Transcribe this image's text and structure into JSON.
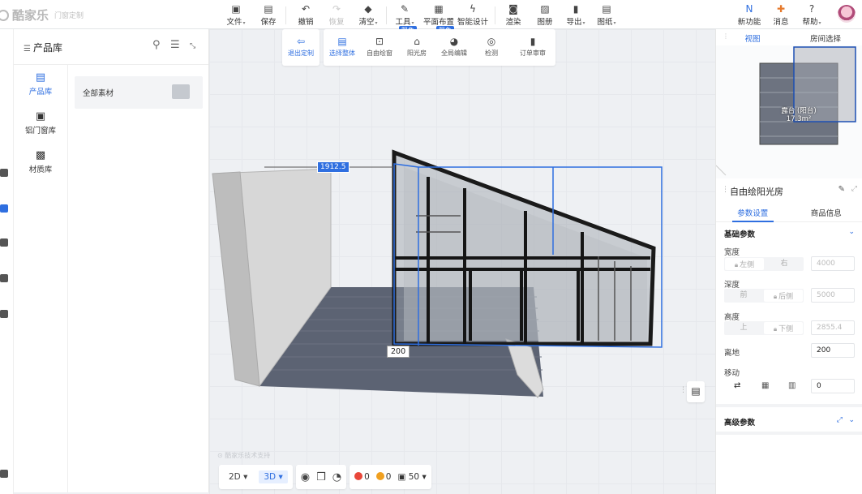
{
  "app": {
    "brand": "酷家乐",
    "module": "门窗定制"
  },
  "toolbar": {
    "file": "文件",
    "save": "保存",
    "undo": "撤销",
    "redo": "恢复",
    "clear": "清空",
    "tools": "工具",
    "layout": "平面布置",
    "smart": "智能设计",
    "render": "渲染",
    "album": "图册",
    "export": "导出",
    "drawings": "图纸",
    "new_feature": "新功能",
    "messages": "消息",
    "help": "帮助",
    "free_badge": "限免"
  },
  "subtoolbar": {
    "exit": "退出定制",
    "select_whole": "选择整体",
    "free_draw": "自由绘窗",
    "sunroom": "阳光房",
    "global_edit": "全局编辑",
    "detect": "检测",
    "order_review": "订单审审"
  },
  "library": {
    "title": "产品库",
    "categories": [
      {
        "label": "产品库",
        "active": true
      },
      {
        "label": "铝门窗库",
        "active": false
      },
      {
        "label": "材质库",
        "active": false
      }
    ],
    "all_materials": "全部素材"
  },
  "viewport": {
    "dim_top": "1912.5",
    "dim_bottom": "200",
    "watermark": "酷家乐技术支持"
  },
  "bottombar": {
    "view2d": "2D",
    "view3d": "3D",
    "errors": "0",
    "warnings": "0",
    "count": "50"
  },
  "right": {
    "mini_tabs": [
      "视图",
      "房间选择"
    ],
    "room_label": "露台 (阳台)",
    "room_area": "17.3m²",
    "panel_title": "自由绘阳光房",
    "tabs": [
      "参数设置",
      "商品信息"
    ],
    "basic_params": "基础参数",
    "width_label": "宽度",
    "width_left": "左侧",
    "width_right": "右",
    "width_value": "4000",
    "depth_label": "深度",
    "depth_front": "前",
    "depth_back": "后侧",
    "depth_value": "5000",
    "height_label": "高度",
    "height_top": "上",
    "height_bottom": "下侧",
    "height_value": "2855.4",
    "offground_label": "离地",
    "offground_value": "200",
    "move_label": "移动",
    "move_value": "0",
    "advanced_params": "高级参数"
  },
  "colors": {
    "accent": "#2f6fe0",
    "error": "#e9473a",
    "warning": "#f0a020"
  }
}
